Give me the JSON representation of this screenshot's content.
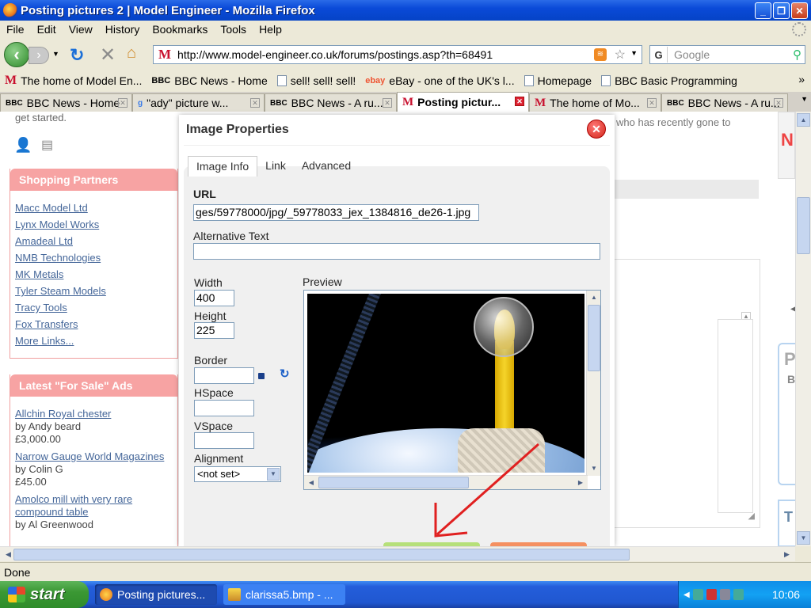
{
  "window": {
    "title": "Posting pictures 2 | Model Engineer - Mozilla Firefox"
  },
  "menu": [
    "File",
    "Edit",
    "View",
    "History",
    "Bookmarks",
    "Tools",
    "Help"
  ],
  "nav": {
    "url": "http://www.model-engineer.co.uk/forums/postings.asp?th=68491",
    "search_placeholder": "Google"
  },
  "bookmarks": [
    {
      "icon": "M",
      "label": "The home of Model En..."
    },
    {
      "icon": "BBC",
      "label": "BBC News - Home"
    },
    {
      "icon": "doc",
      "label": "sell! sell! sell!"
    },
    {
      "icon": "ebay",
      "label": "eBay - one of the UK's l..."
    },
    {
      "icon": "doc",
      "label": "Homepage"
    },
    {
      "icon": "doc",
      "label": "BBC Basic Programming"
    }
  ],
  "tabs": [
    {
      "icon": "BBC",
      "label": "BBC News - Home"
    },
    {
      "icon": "g",
      "label": "\"ady\" picture w..."
    },
    {
      "icon": "BBC",
      "label": "BBC News - A ru..."
    },
    {
      "icon": "M",
      "label": "Posting pictur...",
      "active": true
    },
    {
      "icon": "M",
      "label": "The home of Mo..."
    },
    {
      "icon": "BBC",
      "label": "BBC News - A ru..."
    }
  ],
  "page": {
    "get_started": "get started.",
    "bg_text": "who has recently gone to",
    "side_letter": "N",
    "side_p": "P",
    "side_b": "B",
    "side_t": "T",
    "shopping": {
      "title": "Shopping Partners",
      "links": [
        "Macc Model Ltd",
        "Lynx Model Works",
        "Amadeal Ltd",
        "NMB Technologies",
        "MK Metals",
        "Tyler Steam Models",
        "Tracy Tools",
        "Fox Transfers",
        "More Links..."
      ]
    },
    "forsale": {
      "title": "Latest \"For Sale\" Ads",
      "items": [
        {
          "title": "Allchin Royal chester",
          "by": "by Andy beard",
          "price": "£3,000.00"
        },
        {
          "title": "Narrow Gauge World Magazines",
          "by": "by Colin G",
          "price": "£45.00"
        },
        {
          "title": "Amolco mill with very rare compound table",
          "by": "by Al Greenwood",
          "price": ""
        }
      ]
    }
  },
  "dialog": {
    "title": "Image Properties",
    "tabs": [
      "Image Info",
      "Link",
      "Advanced"
    ],
    "url_label": "URL",
    "url_value": "ges/59778000/jpg/_59778033_jex_1384816_de26-1.jpg",
    "alt_label": "Alternative Text",
    "alt_value": "",
    "width_label": "Width",
    "width_value": "400",
    "height_label": "Height",
    "height_value": "225",
    "border_label": "Border",
    "hspace_label": "HSpace",
    "vspace_label": "VSpace",
    "alignment_label": "Alignment",
    "alignment_value": "<not set>",
    "preview_label": "Preview"
  },
  "status": "Done",
  "taskbar": {
    "start": "start",
    "tasks": [
      "Posting pictures...",
      "clarissa5.bmp - ..."
    ],
    "clock": "10:06"
  },
  "colors": {
    "accent_pink": "#f7a3a3",
    "arrow_red": "#e02020",
    "xp_blue": "#245edb"
  }
}
